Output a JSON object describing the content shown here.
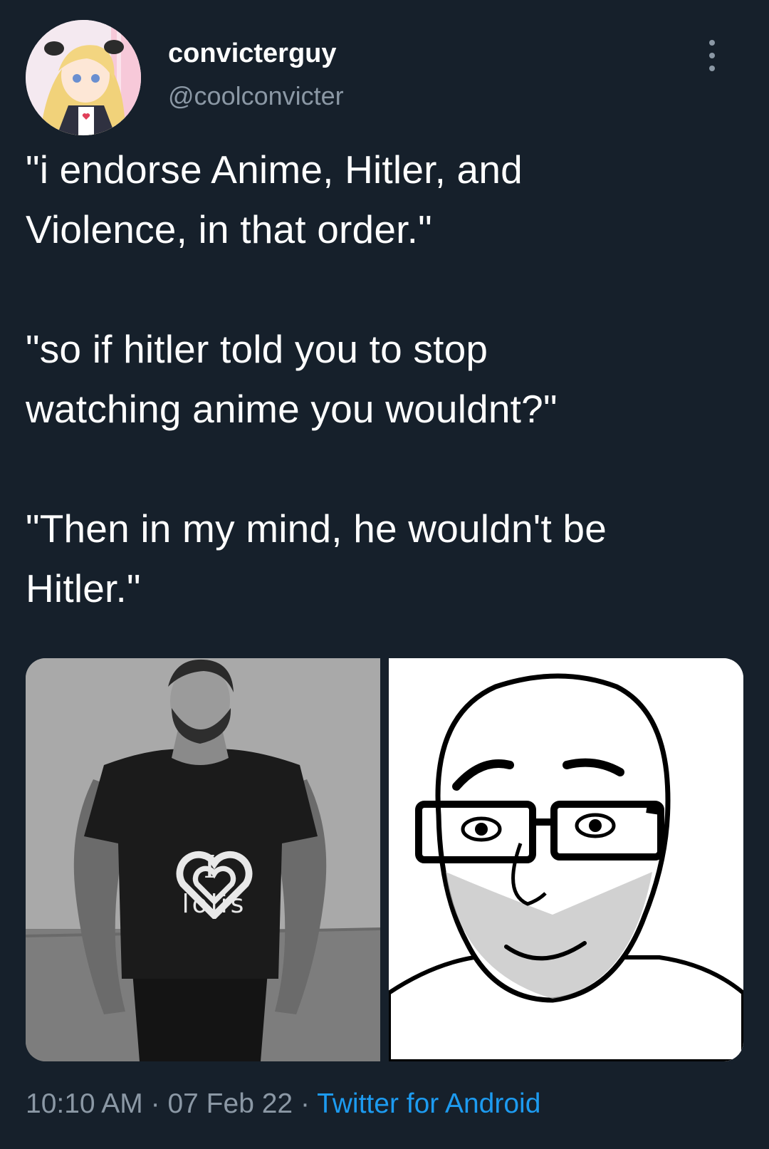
{
  "user": {
    "display_name": "convicterguy",
    "handle": "@coolconvicter"
  },
  "tweet": {
    "text": "\"i endorse Anime, Hitler, and\nViolence, in that order.\"\n\n\"so if hitler told you to stop\nwatching anime you wouldnt?\"\n\n\"Then in my mind, he wouldn't be\nHitler.\""
  },
  "media": {
    "left_image": {
      "subject": "muscular-man-photo",
      "shirt_line1": "I",
      "shirt_line2": "lolis"
    },
    "right_image": {
      "subject": "wojak-glasses-drawing"
    }
  },
  "footer": {
    "time": "10:10 AM",
    "separator": "·",
    "date": "07 Feb 22",
    "source": "Twitter for Android"
  },
  "colors": {
    "background": "#16202b",
    "secondary_text": "#8b98a5",
    "link": "#1d9bf0"
  }
}
